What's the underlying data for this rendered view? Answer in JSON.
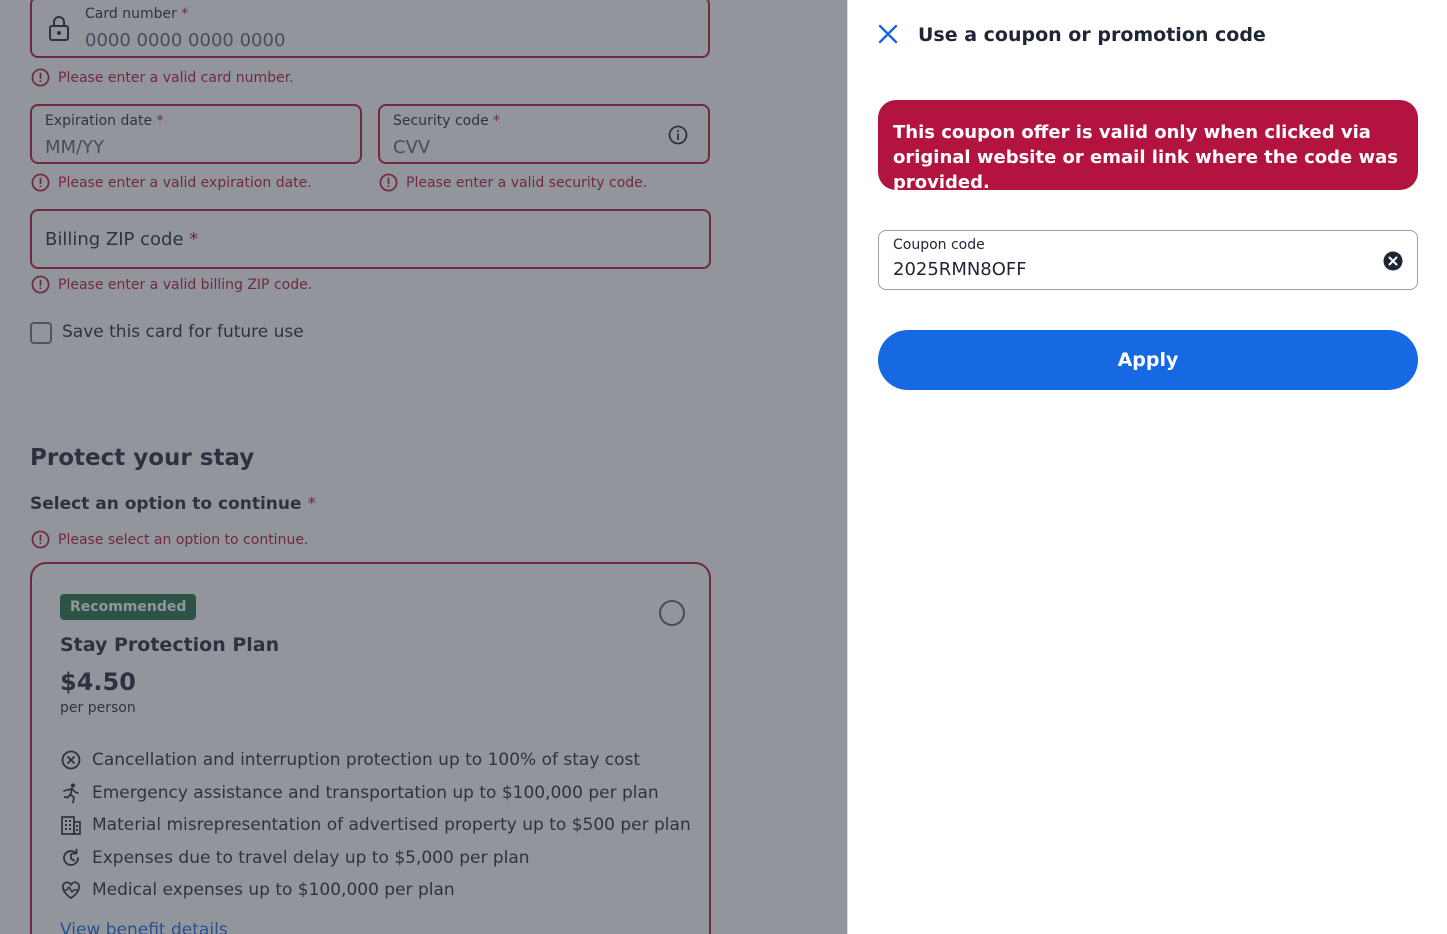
{
  "payment": {
    "card_number": {
      "label": "Card number",
      "required_mark": "*",
      "placeholder": "0000 0000 0000 0000",
      "error": "Please enter a valid card number."
    },
    "expiration": {
      "label": "Expiration date",
      "required_mark": "*",
      "placeholder": "MM/YY",
      "error": "Please enter a valid expiration date."
    },
    "security": {
      "label": "Security code",
      "required_mark": "*",
      "placeholder": "CVV",
      "error": "Please enter a valid security code."
    },
    "zip": {
      "label": "Billing ZIP code",
      "required_mark": "*",
      "error": "Please enter a valid billing ZIP code."
    },
    "save_card_label": "Save this card for future use"
  },
  "protect": {
    "heading": "Protect your stay",
    "select_label": "Select an option to continue",
    "required_mark": "*",
    "error": "Please select an option to continue.",
    "plan": {
      "badge": "Recommended",
      "title": "Stay Protection Plan",
      "price": "$4.50",
      "unit": "per person",
      "benefits": [
        {
          "icon": "cancel-circle-icon",
          "text": "Cancellation and interruption protection up to 100% of stay cost"
        },
        {
          "icon": "running-person-icon",
          "text": "Emergency assistance and transportation up to $100,000 per plan"
        },
        {
          "icon": "building-icon",
          "text": "Material misrepresentation of advertised property up to $500 per plan"
        },
        {
          "icon": "clock-refresh-icon",
          "text": "Expenses due to travel delay up to $5,000 per plan"
        },
        {
          "icon": "heartbeat-icon",
          "text": "Medical expenses up to $100,000 per plan"
        }
      ],
      "link": "View benefit details"
    }
  },
  "coupon_panel": {
    "title": "Use a coupon or promotion code",
    "alert": "This coupon offer is valid only when clicked via original website or email link where the code was provided.",
    "field_label": "Coupon code",
    "field_value": "2025RMN8OFF",
    "apply_label": "Apply"
  },
  "colors": {
    "error": "#b3112e",
    "alert_bg": "#b3143f",
    "primary": "#1668e3",
    "badge": "#1e6e3e"
  }
}
